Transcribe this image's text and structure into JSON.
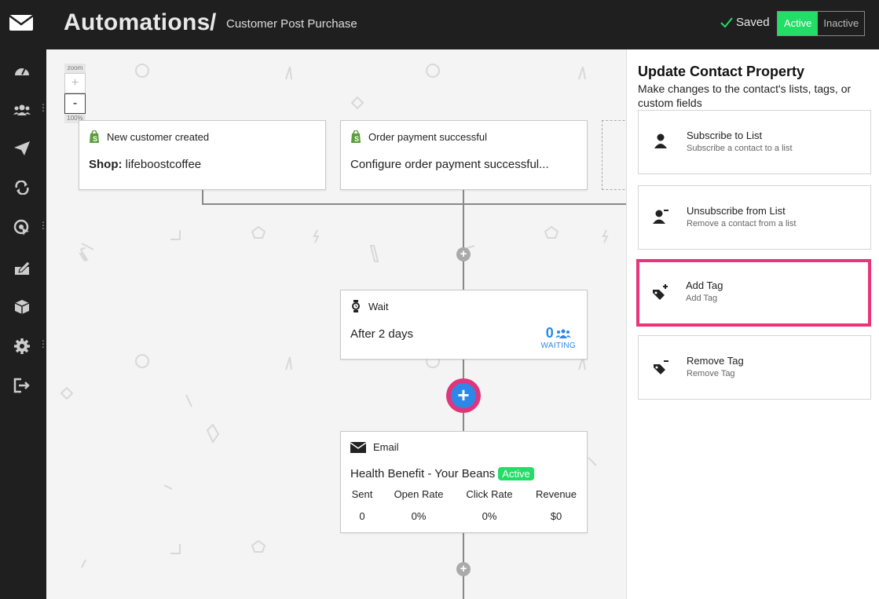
{
  "header": {
    "title": "Automations",
    "separator": "/",
    "subtitle": "Customer Post Purchase",
    "saved_label": "Saved",
    "toggle_active": "Active",
    "toggle_inactive": "Inactive"
  },
  "sidebar": {
    "items": [
      {
        "icon": "dashboard-icon"
      },
      {
        "icon": "contacts-icon"
      },
      {
        "icon": "campaigns-icon"
      },
      {
        "icon": "automations-icon"
      },
      {
        "icon": "targeting-icon"
      },
      {
        "icon": "forms-icon"
      },
      {
        "icon": "products-icon"
      },
      {
        "icon": "settings-icon"
      },
      {
        "icon": "logout-icon"
      }
    ]
  },
  "zoom": {
    "label": "zoom",
    "plus": "+",
    "minus": "-",
    "level": "100%"
  },
  "triggers": [
    {
      "title": "New customer created",
      "body_bold": "Shop:",
      "body_value": "lifeboostcoffee"
    },
    {
      "title": "Order payment successful",
      "body": "Configure order payment successful..."
    }
  ],
  "wait_step": {
    "title": "Wait",
    "body": "After 2 days",
    "waiting_count": "0",
    "waiting_label": "WAITING"
  },
  "email_step": {
    "title": "Email",
    "name": "Health Benefit - Your Beans",
    "status": "Active",
    "stats_headers": [
      "Sent",
      "Open Rate",
      "Click Rate",
      "Revenue"
    ],
    "stats_values": [
      "0",
      "0%",
      "0%",
      "$0"
    ]
  },
  "panel": {
    "title": "Update Contact Property",
    "description": "Make changes to the contact's lists, tags, or custom fields",
    "actions": [
      {
        "title": "Subscribe to List",
        "subtitle": "Subscribe a contact to a list"
      },
      {
        "title": "Unsubscribe from List",
        "subtitle": "Remove a contact from a list"
      },
      {
        "title": "Add Tag",
        "subtitle": "Add Tag"
      },
      {
        "title": "Remove Tag",
        "subtitle": "Remove Tag"
      }
    ]
  },
  "colors": {
    "accent_green": "#22dd66",
    "highlight_pink": "#e8357a",
    "add_blue": "#2b87e8",
    "dark_bg": "#1f1f1f"
  }
}
